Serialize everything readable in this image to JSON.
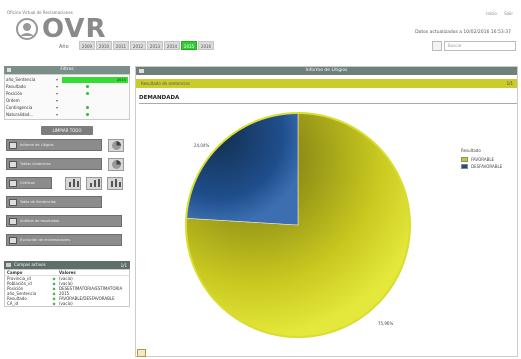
{
  "header": {
    "subtitle": "Oficina Virtual de Reclamaciones",
    "app_name": "OVR",
    "year_label": "Año",
    "years": [
      "2009",
      "2010",
      "2011",
      "2012",
      "2013",
      "2014",
      "2015",
      "2016"
    ],
    "active_year": "2015",
    "top_links": [
      "Inicio",
      "Salir"
    ],
    "updated_text": "Datos actualizados a 10/02/2016 16:53:37",
    "search_placeholder": "Buscar"
  },
  "filters": {
    "title": "Filtros",
    "rows": [
      {
        "name": "año_Sentencia",
        "value": "2015",
        "selected": true
      },
      {
        "name": "Resultado",
        "value": "",
        "dot": true
      },
      {
        "name": "Posición",
        "value": "",
        "dot": true
      },
      {
        "name": "Ordem",
        "value": "",
        "dot": false
      },
      {
        "name": "Contingencia",
        "value": "",
        "dot": true
      },
      {
        "name": "Naturalidad...",
        "value": "",
        "dot": true
      }
    ],
    "clear_label": "LIMPIAR TODO"
  },
  "tools": {
    "buttons": [
      "Informe de Litigios",
      "Tablas dinámicas",
      "Gráficos",
      "Tabla de Sentencias",
      "Análisis de resultados",
      "Evolución de reclamaciones"
    ]
  },
  "fields_panel": {
    "title": "Campos activos",
    "counter": "1/1",
    "headers": [
      "Campo",
      "Valores"
    ],
    "rows": [
      {
        "field": "Provincia_id",
        "value": "(vacío)"
      },
      {
        "field": "Población_id",
        "value": "(vacío)"
      },
      {
        "field": "Posición",
        "value": "DESESTIMATORIA/ESTIMATORIA"
      },
      {
        "field": "año_Sentencia",
        "value": "2015"
      },
      {
        "field": "Resultado",
        "value": "FAVORABLE/DESFAVORABLE"
      },
      {
        "field": "CA_id",
        "value": "(vacío)"
      }
    ]
  },
  "report": {
    "title": "Informe de Litigios",
    "chart_bar_title": "Resultado de sentencias",
    "chart_bar_counter": "1/1",
    "heading": "DEMANDADA"
  },
  "chart_data": {
    "type": "pie",
    "title": "DEMANDADA",
    "legend_title": "Resultado",
    "legend_position": "right",
    "slices": [
      {
        "label": "FAVORABLE",
        "value": 75.96,
        "display": "75,96%",
        "color": "#c8c820"
      },
      {
        "label": "DESFAVORABLE",
        "value": 24.04,
        "display": "24,04%",
        "color": "#1f4e8c"
      }
    ]
  }
}
